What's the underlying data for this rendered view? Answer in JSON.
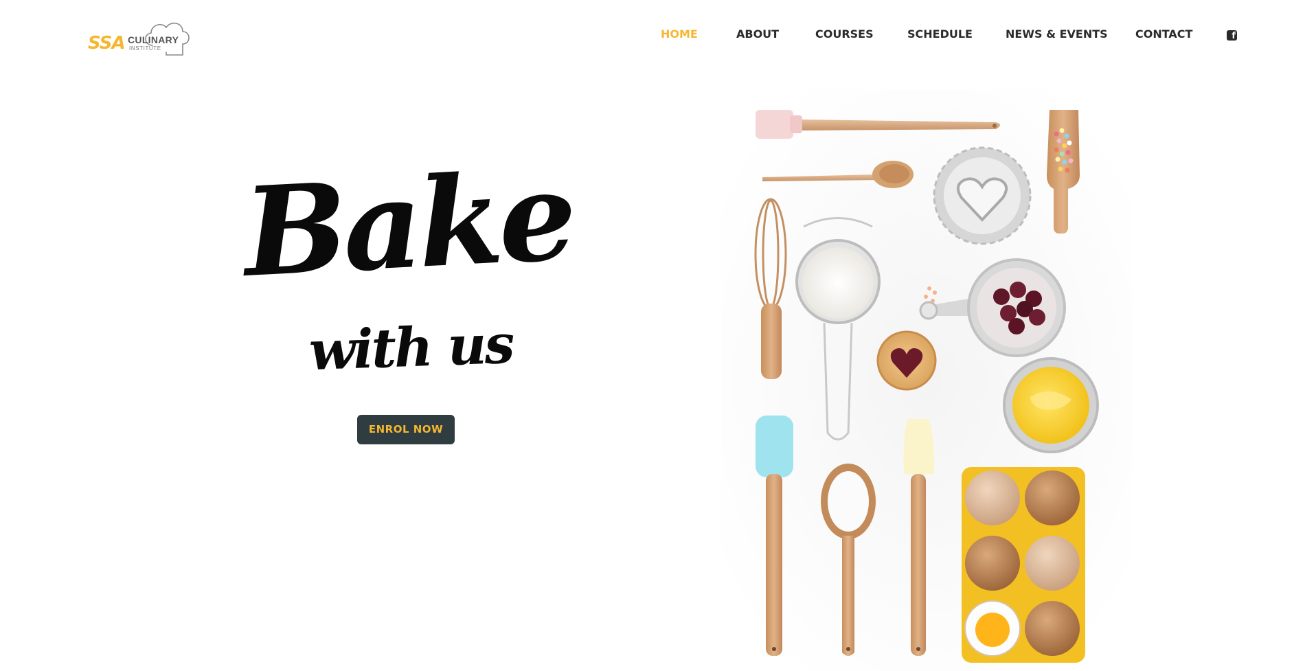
{
  "brand": {
    "ssa": "SSA",
    "culinary": "CULINARY",
    "institute": "INSTITUTE"
  },
  "nav": {
    "items": [
      {
        "label": "HOME",
        "active": true
      },
      {
        "label": "ABOUT",
        "active": false
      },
      {
        "label": "COURSES",
        "active": false
      },
      {
        "label": "SCHEDULE",
        "active": false
      },
      {
        "label": "NEWS & EVENTS",
        "active": false
      },
      {
        "label": "CONTACT",
        "active": false
      }
    ],
    "facebook_glyph": "f",
    "facebook_icon": "facebook-icon"
  },
  "hero": {
    "title_big": "Bake",
    "title_small": "with us",
    "cta_label": "ENROL NOW"
  },
  "colors": {
    "accent": "#f5b731",
    "button_bg": "#2f3d40",
    "text_dark": "#2a2a2a"
  }
}
